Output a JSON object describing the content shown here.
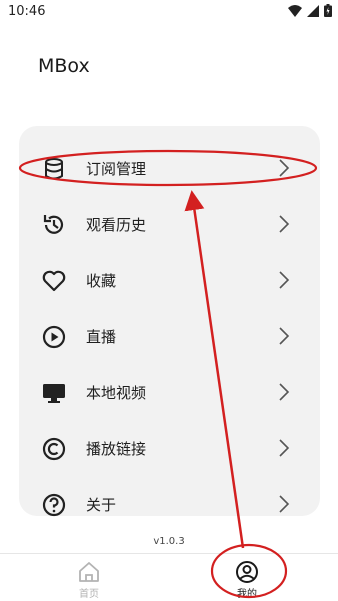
{
  "status_bar": {
    "time": "10:46"
  },
  "app": {
    "title": "MBox"
  },
  "menu": {
    "items": [
      {
        "label": "订阅管理",
        "icon": "database-icon"
      },
      {
        "label": "观看历史",
        "icon": "history-icon"
      },
      {
        "label": "收藏",
        "icon": "heart-icon"
      },
      {
        "label": "直播",
        "icon": "play-circle-icon"
      },
      {
        "label": "本地视频",
        "icon": "monitor-icon"
      },
      {
        "label": "播放链接",
        "icon": "copyright-icon"
      },
      {
        "label": "关于",
        "icon": "help-circle-icon"
      }
    ]
  },
  "version": "v1.0.3",
  "bottom_nav": {
    "home_label": "首页",
    "mine_label": "我的"
  },
  "colors": {
    "annotation_red": "#d32020",
    "card_bg": "#f2f2f2",
    "inactive_tab": "#b3b3b3"
  }
}
